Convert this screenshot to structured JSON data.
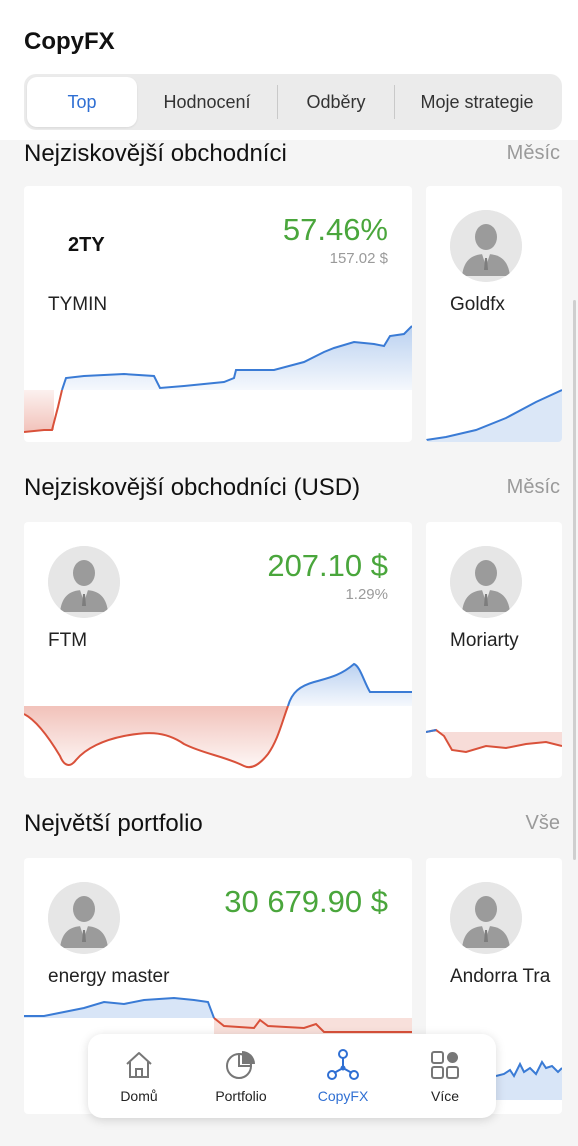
{
  "app": {
    "title": "CopyFX"
  },
  "tabs": [
    {
      "label": "Top",
      "active": true
    },
    {
      "label": "Hodnocení",
      "active": false
    },
    {
      "label": "Odběry",
      "active": false
    },
    {
      "label": "Moje strategie",
      "active": false
    }
  ],
  "sections": [
    {
      "title": "Nejziskovější obchodníci",
      "link": "Měsíc",
      "cards": [
        {
          "logo_text": "2TY",
          "name": "TYMIN",
          "value": "57.46%",
          "sub": "157.02 $"
        },
        {
          "name": "Goldfx"
        }
      ]
    },
    {
      "title": "Nejziskovější obchodníci (USD)",
      "link": "Měsíc",
      "cards": [
        {
          "name": "FTM",
          "value": "207.10 $",
          "sub": "1.29%"
        },
        {
          "name": "Moriarty"
        }
      ]
    },
    {
      "title": "Největší portfolio",
      "link": "Vše",
      "cards": [
        {
          "name": "energy master",
          "value": "30 679.90 $"
        },
        {
          "name": "Andorra Tra"
        }
      ]
    }
  ],
  "nav": [
    {
      "label": "Domů",
      "icon": "home-icon",
      "active": false
    },
    {
      "label": "Portfolio",
      "icon": "pie-chart-icon",
      "active": false
    },
    {
      "label": "CopyFX",
      "icon": "copyfx-network-icon",
      "active": true
    },
    {
      "label": "Více",
      "icon": "apps-grid-icon",
      "active": false
    }
  ],
  "colors": {
    "accent": "#2f6fd3",
    "profit_text": "#4aa63c",
    "chart_positive": "#3a7bd5",
    "chart_negative": "#d9513a"
  }
}
